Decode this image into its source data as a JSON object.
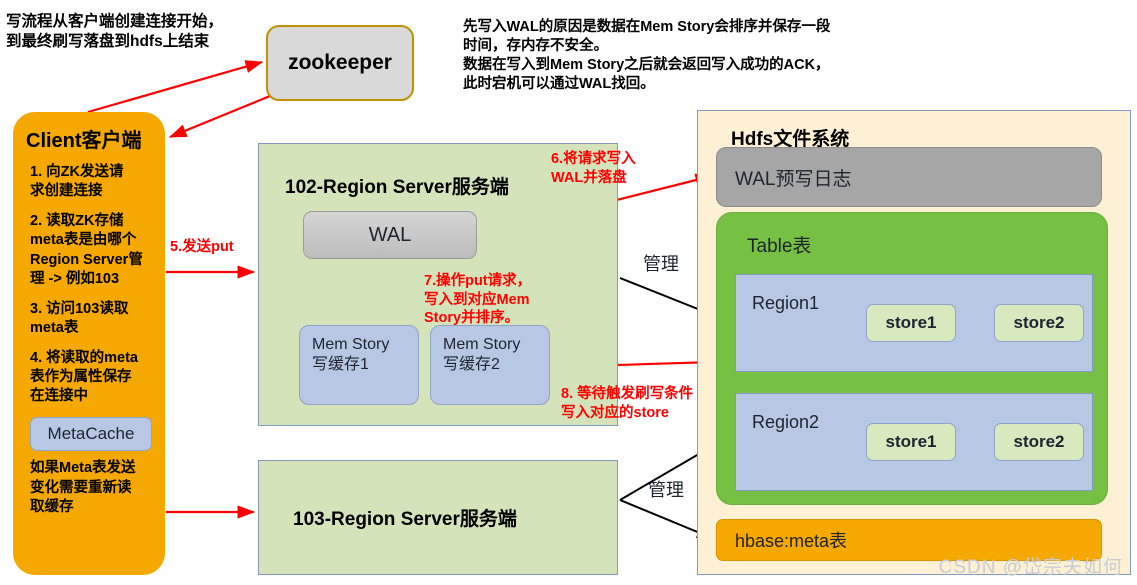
{
  "diagram": {
    "intro_note": "写流程从客户端创建连接开始，\n到最终刷写落盘到hdfs上结束",
    "wal_note": "先写入WAL的原因是数据在Mem Story会排序并保存一段\n时间，存内存不安全。\n数据在写入到Mem Story之后就会返回写入成功的ACK，\n此时宕机可以通过WAL找回。",
    "watermark": "CSDN @岱宗夫如何"
  },
  "zookeeper": {
    "label": "zookeeper"
  },
  "client": {
    "title": "Client客户端",
    "steps": [
      "1. 向ZK发送请\n求创建连接",
      "2. 读取ZK存储\nmeta表是由哪个\nRegion Server管\n理 -> 例如103",
      "3. 访问103读取\nmeta表",
      "4. 将读取的meta\n表作为属性保存\n在连接中"
    ],
    "metacache_label": "MetaCache",
    "footer_note": "如果Meta表发送\n变化需要重新读\n取缓存"
  },
  "region_server_102": {
    "title": "102-Region Server服务端",
    "wal_label": "WAL",
    "mem_stores": [
      "Mem Story\n写缓存1",
      "Mem Story\n写缓存2"
    ]
  },
  "region_server_103": {
    "title": "103-Region Server服务端"
  },
  "hdfs": {
    "title": "Hdfs文件系统",
    "wal_log_label": "WAL预写日志",
    "table": {
      "title": "Table表",
      "regions": [
        {
          "label": "Region1",
          "stores": [
            "store1",
            "store2"
          ]
        },
        {
          "label": "Region2",
          "stores": [
            "store1",
            "store2"
          ]
        }
      ]
    },
    "meta_table_label": "hbase:meta表"
  },
  "annotations": {
    "red": [
      {
        "id": "5",
        "text": "5.发送put"
      },
      {
        "id": "6",
        "text": "6.将请求写入\nWAL并落盘"
      },
      {
        "id": "7",
        "text": "7.操作put请求，\n写入到对应Mem\nStory并排序。"
      },
      {
        "id": "8",
        "text": "8. 等待触发刷写条件\n写入对应的store"
      }
    ],
    "black": [
      {
        "id": "manage-top",
        "text": "管理"
      },
      {
        "id": "manage-bottom",
        "text": "管理"
      }
    ]
  },
  "colors": {
    "client_orange": "#f5a800",
    "region_server_green": "#d5e3bb",
    "hdfs_cream": "#fdf0d5",
    "table_green": "#76c043",
    "region_blue": "#b8c8e4",
    "store_green": "#d8e9c0",
    "wal_gray": "#c6c6c6",
    "arrow_red": "#ff0000",
    "arrow_black": "#000000"
  }
}
